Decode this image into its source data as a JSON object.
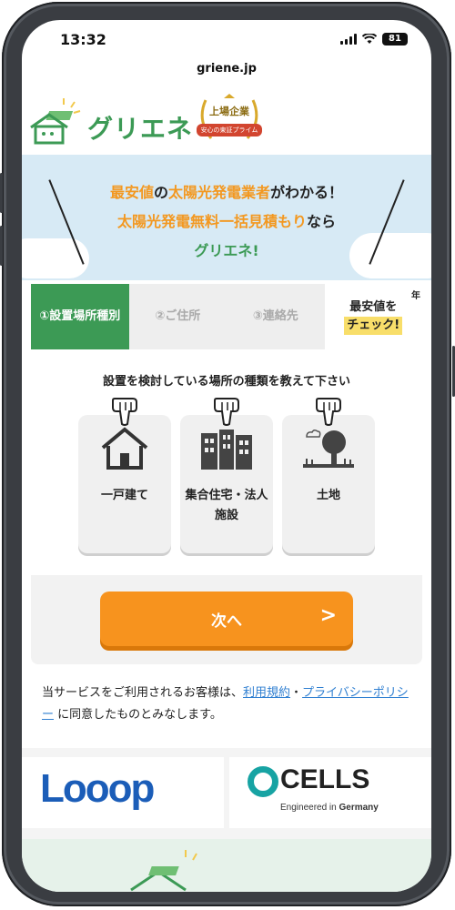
{
  "status_bar": {
    "time": "13:32",
    "battery": "81"
  },
  "browser": {
    "url": "griene.jp"
  },
  "header": {
    "logo_text": "グリエネ",
    "badge_line1": "上場企業",
    "badge_line2": "安心の東証プライム"
  },
  "hero": {
    "line1": [
      {
        "text": "最安値",
        "color": "orange"
      },
      {
        "text": "の",
        "color": "dark"
      },
      {
        "text": "太陽光発電業者",
        "color": "orange"
      },
      {
        "text": "がわかる！",
        "color": "dark"
      }
    ],
    "line2": [
      {
        "text": "太陽光発電無料一括見積もり",
        "color": "orange"
      },
      {
        "text": "なら",
        "color": "dark"
      }
    ],
    "line3": "グリエネ!"
  },
  "steps": {
    "step1": "①設置場所種別",
    "step2": "②ご住所",
    "step3": "③連絡先",
    "final_line1": "最安値を",
    "final_line2": "チェック!",
    "final_mark": "年"
  },
  "form": {
    "question": "設置を検討している場所の種類を教えて下さい",
    "options": [
      {
        "label": "一戸建て",
        "icon": "house-icon"
      },
      {
        "label": "集合住宅・法人施設",
        "icon": "apartment-building-icon"
      },
      {
        "label": "土地",
        "icon": "land-tree-icon"
      }
    ],
    "next_label": "次へ",
    "next_arrow": ">"
  },
  "terms": {
    "prefix": "当サービスをご利用されるお客様は、",
    "link1": "利用規約",
    "sep": "・",
    "link2": "プライバシーポリシー",
    "suffix": " に同意したものとみなします。"
  },
  "partners": {
    "partner1": "Looop",
    "partner2_name": "CELLS",
    "partner2_tag_prefix": "Engineered in ",
    "partner2_tag_bold": "Germany"
  },
  "colors": {
    "brand_green": "#3c9a55",
    "accent_orange": "#f7931e",
    "hero_bg": "#d7eaf5",
    "link_blue": "#2f7fd1"
  }
}
